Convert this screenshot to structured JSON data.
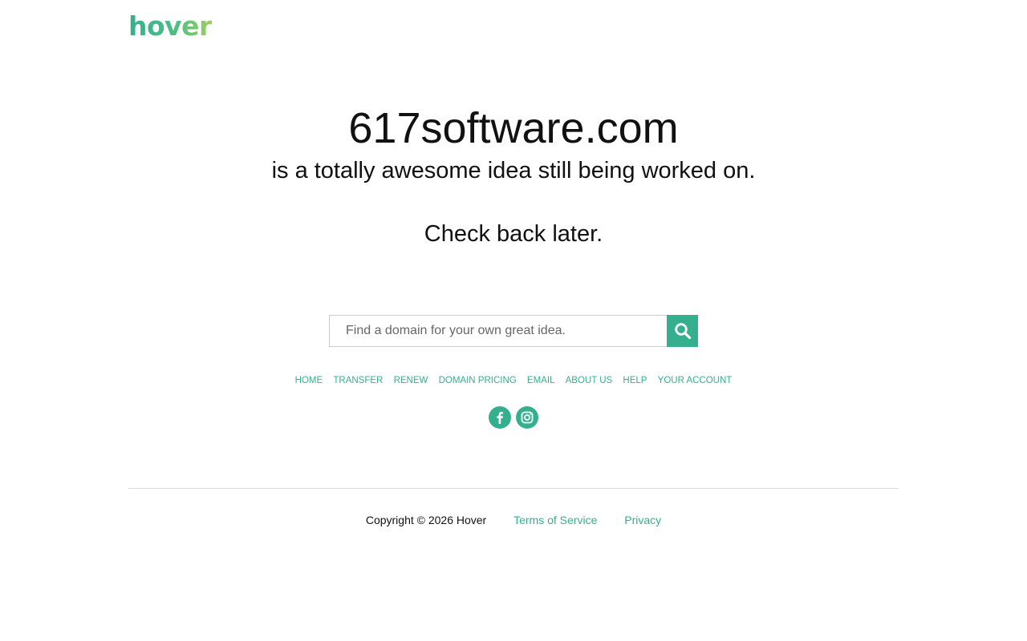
{
  "brand": {
    "logo_text": "hover",
    "accent_color": "#35b08e",
    "gradient_end_color": "#9bd05c"
  },
  "main": {
    "domain": "617software.com",
    "tagline": "is a totally awesome idea still being worked on.",
    "check_back": "Check back later."
  },
  "search": {
    "placeholder": "Find a domain for your own great idea.",
    "value": "",
    "button_icon": "search-icon"
  },
  "nav": {
    "items": [
      {
        "label": "HOME"
      },
      {
        "label": "TRANSFER"
      },
      {
        "label": "RENEW"
      },
      {
        "label": "DOMAIN PRICING"
      },
      {
        "label": "EMAIL"
      },
      {
        "label": "ABOUT US"
      },
      {
        "label": "HELP"
      },
      {
        "label": "YOUR ACCOUNT"
      }
    ]
  },
  "social": {
    "icons": [
      "facebook-icon",
      "instagram-icon"
    ]
  },
  "footer": {
    "copyright": "Copyright © 2026 Hover",
    "terms": "Terms of Service",
    "privacy": "Privacy"
  }
}
